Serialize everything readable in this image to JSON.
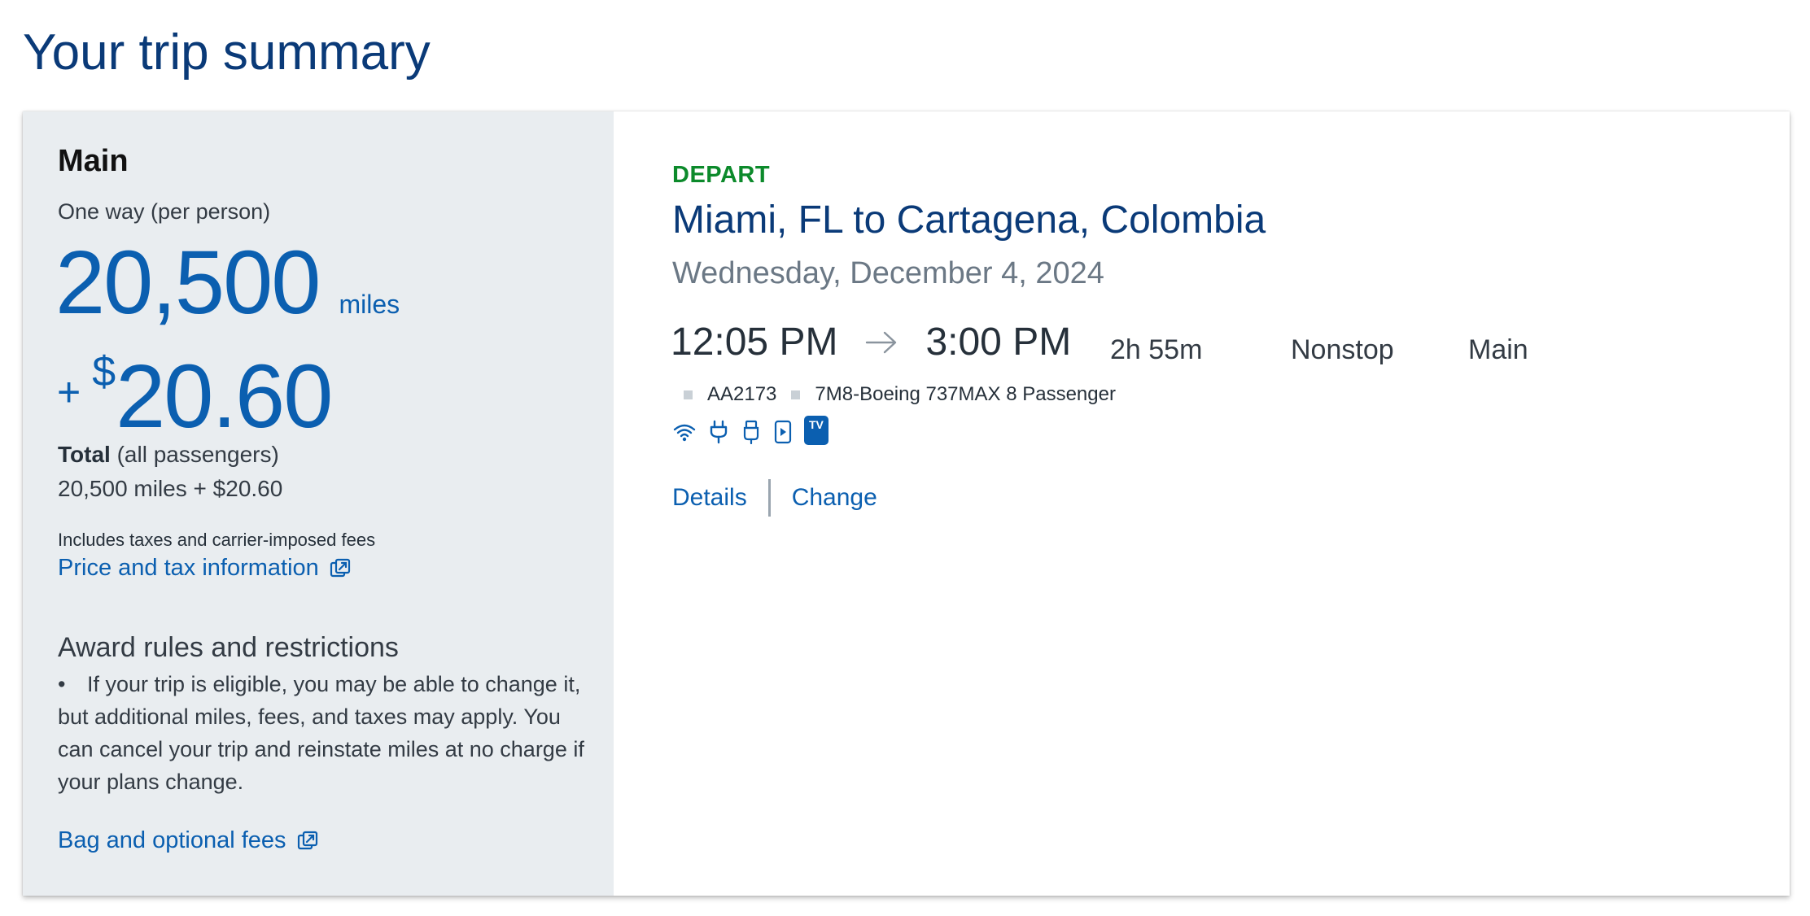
{
  "page": {
    "title": "Your trip summary"
  },
  "fare": {
    "cabin": "Main",
    "fare_type": "One way (per person)",
    "miles_value": "20,500",
    "miles_unit": "miles",
    "cash_plus": "+",
    "cash_currency": "$",
    "cash_value": "20.60",
    "total_label": "Total",
    "total_qualifier": "(all passengers)",
    "total_amount": "20,500 miles + $20.60",
    "includes_text": "Includes taxes and carrier-imposed fees",
    "price_link": "Price and tax information",
    "rules_title": "Award rules and restrictions",
    "rules_bullet": "•",
    "rules_text": "If your trip is eligible, you may be able to change it, but additional miles, fees, and taxes may apply. You can cancel your trip and reinstate miles at no charge if your plans change.",
    "bag_link": "Bag and optional fees"
  },
  "flight": {
    "direction_label": "DEPART",
    "route": "Miami, FL to Cartagena, Colombia",
    "date": "Wednesday, December 4, 2024",
    "depart_time": "12:05 PM",
    "arrive_time": "3:00 PM",
    "duration": "2h 55m",
    "stops": "Nonstop",
    "cabin": "Main",
    "flight_number": "AA2173",
    "aircraft": "7M8-Boeing 737MAX 8 Passenger",
    "amenities": [
      "wifi-icon",
      "power-outlet-icon",
      "usb-icon",
      "streaming-device-icon",
      "tv-icon"
    ],
    "tv_badge": "TV",
    "details_link": "Details",
    "change_link": "Change"
  },
  "colors": {
    "title_blue": "#0a3a78",
    "link_blue": "#0b5fb0",
    "depart_green": "#0c8a2b",
    "panel_gray": "#e9edf0",
    "date_gray": "#6b7885"
  }
}
